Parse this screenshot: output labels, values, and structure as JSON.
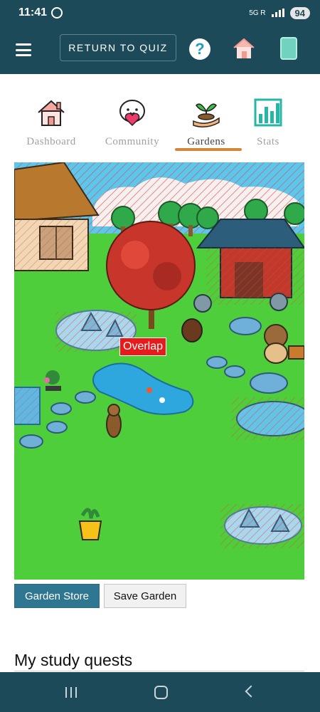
{
  "status_bar": {
    "time": "11:41",
    "network": "5G R",
    "battery": "94"
  },
  "app_bar": {
    "return_label": "RETURN TO QUIZ",
    "help_symbol": "?"
  },
  "tabs": [
    {
      "label": "Dashboard",
      "icon": "house-icon",
      "active": false
    },
    {
      "label": "Community",
      "icon": "heart-face-icon",
      "active": false
    },
    {
      "label": "Gardens",
      "icon": "sprout-hand-icon",
      "active": true
    },
    {
      "label": "Stats",
      "icon": "bar-chart-icon",
      "active": false
    }
  ],
  "garden": {
    "overlap_label": "Overlap"
  },
  "buttons": {
    "garden_store": "Garden Store",
    "save_garden": "Save Garden"
  },
  "quests": {
    "heading": "My study quests"
  },
  "colors": {
    "brand": "#1d4a58",
    "accent": "#d4863a",
    "primary_button": "#2f7690",
    "grass": "#4fce3c",
    "overlap": "#e81b1b"
  }
}
